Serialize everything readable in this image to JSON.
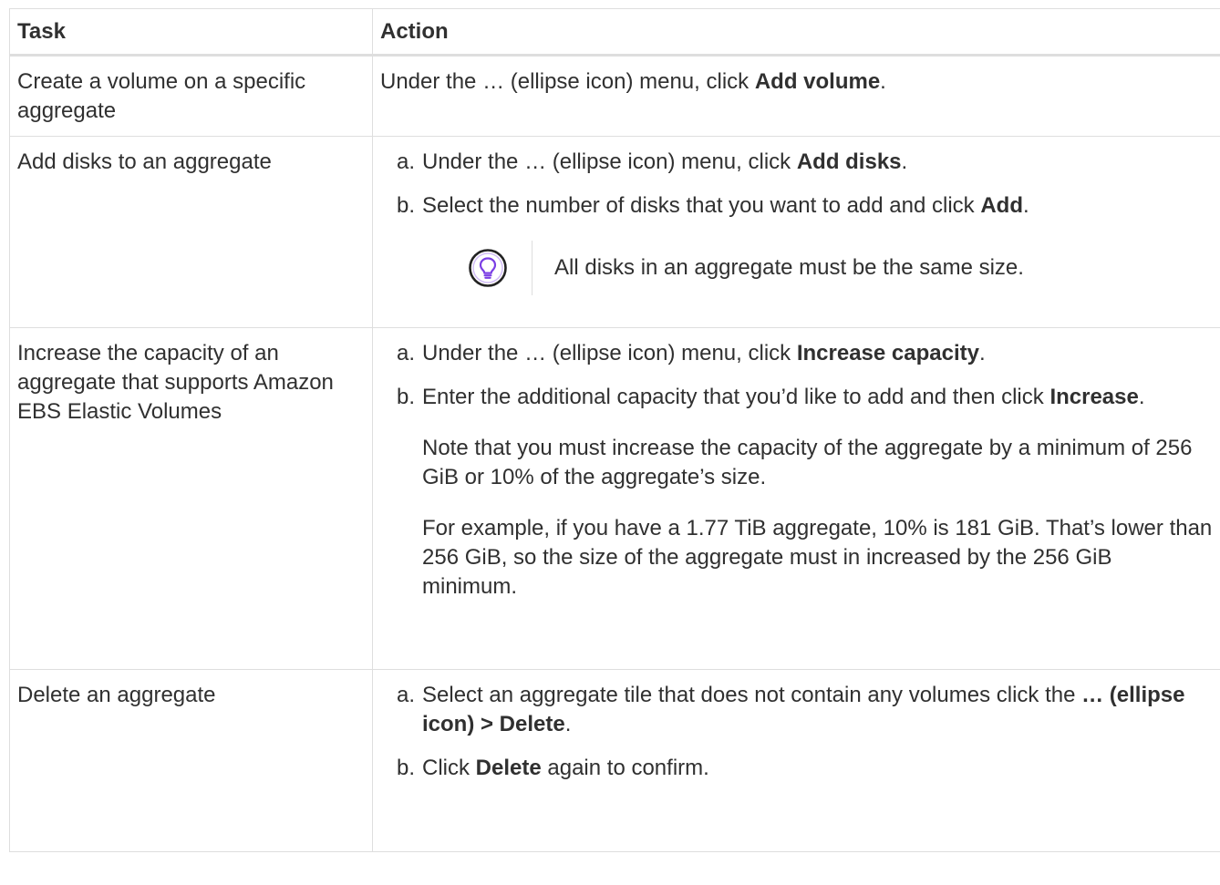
{
  "table": {
    "headers": {
      "task": "Task",
      "action": "Action"
    },
    "rows": [
      {
        "task": "Create a volume on a specific aggregate",
        "action": {
          "prefix": "Under the … (ellipse icon) menu, click ",
          "bold": "Add volume",
          "suffix": "."
        }
      },
      {
        "task": "Add disks to an aggregate",
        "steps": [
          {
            "marker": "a.",
            "prefix": "Under the … (ellipse icon) menu, click ",
            "bold": "Add disks",
            "suffix": "."
          },
          {
            "marker": "b.",
            "prefix": "Select the number of disks that you want to add and click ",
            "bold": "Add",
            "suffix": "."
          }
        ],
        "tip": {
          "icon": "lightbulb-icon",
          "text": "All disks in an aggregate must be the same size."
        }
      },
      {
        "task": "Increase the capacity of an aggregate that supports Amazon EBS Elastic Volumes",
        "steps": [
          {
            "marker": "a.",
            "prefix": "Under the … (ellipse icon) menu, click ",
            "bold": "Increase capacity",
            "suffix": "."
          },
          {
            "marker": "b.",
            "prefix": "Enter the additional capacity that you’d like to add and then click ",
            "bold": "Increase",
            "suffix": "."
          }
        ],
        "notes": [
          "Note that you must increase the capacity of the aggregate by a minimum of 256 GiB or 10% of the aggregate’s size.",
          "For example, if you have a 1.77 TiB aggregate, 10% is 181 GiB. That’s lower than 256 GiB, so the size of the aggregate must in increased by the 256 GiB minimum."
        ]
      },
      {
        "task": "Delete an aggregate",
        "steps": [
          {
            "marker": "a.",
            "prefix": "Select an aggregate tile that does not contain any volumes click the ",
            "bold": "… (ellipse icon) > Delete",
            "suffix": "."
          },
          {
            "marker": "b.",
            "prefix": "Click ",
            "bold": "Delete",
            "suffix": " again to confirm."
          }
        ]
      }
    ]
  },
  "colors": {
    "tip_icon": "#7b3fe4",
    "border": "#dedede",
    "text": "#303030"
  }
}
